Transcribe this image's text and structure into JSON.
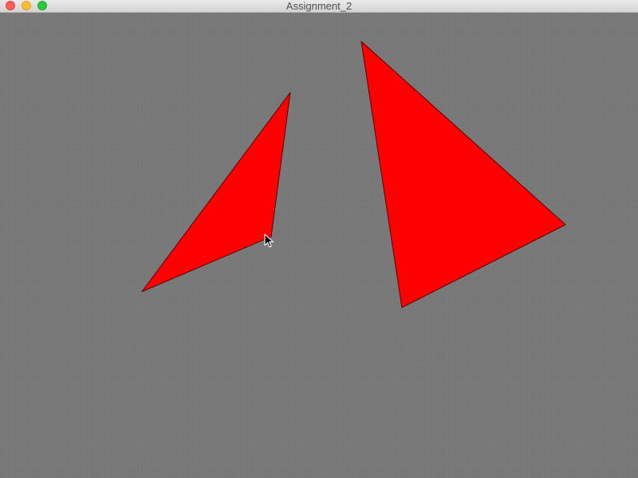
{
  "window": {
    "title": "Assignment_2"
  },
  "colors": {
    "canvas_background": "#7a7a7a",
    "triangle_fill": "#ff0000",
    "triangle_stroke": "#5a0000"
  },
  "icons": {
    "cursor": "arrow-cursor-icon"
  }
}
